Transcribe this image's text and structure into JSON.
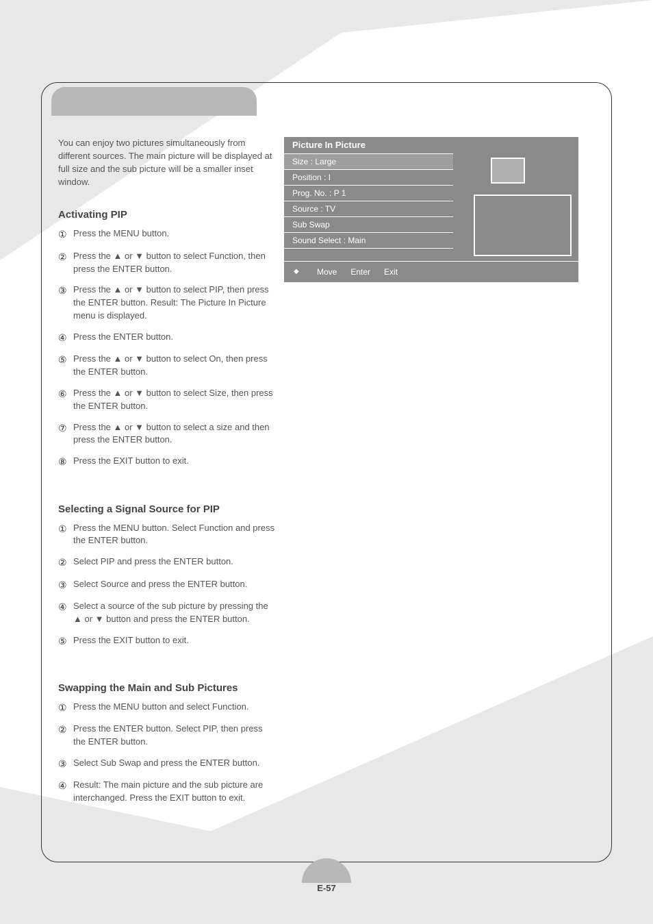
{
  "page": {
    "number": "E-57"
  },
  "tab_title": "Picture In Picture",
  "intro_text": "You can enjoy two pictures simultaneously from different sources. The main picture will be displayed at full size and the sub picture will be a smaller inset window.",
  "osd": {
    "header": "Picture In Picture",
    "rows": [
      "Size : Large",
      "Position : I",
      "Prog. No. : P 1",
      "Source : TV",
      "Sub Swap",
      "Sound Select : Main"
    ],
    "footer_move": "Move",
    "footer_enter": "Enter",
    "footer_exit": "Exit"
  },
  "sections": [
    {
      "title": "Activating PIP",
      "steps": [
        "Press the MENU button.",
        "Press the ▲ or ▼ button to select Function, then press the ENTER button.",
        "Press the ▲ or ▼ button to select PIP, then press the ENTER button. Result: The Picture In Picture menu is displayed.",
        "Press the ENTER button.",
        "Press the ▲ or ▼ button to select On, then press the ENTER button.",
        "Press the ▲ or ▼ button to select Size, then press the ENTER button.",
        "Press the ▲ or ▼ button to select a size and then press the ENTER button.",
        "Press the EXIT button to exit."
      ]
    },
    {
      "title": "Selecting a Signal Source for PIP",
      "steps": [
        "Press the MENU button. Select Function and press the ENTER button.",
        "Select PIP and press the ENTER button.",
        "Select Source and press the ENTER button.",
        "Select a source of the sub picture by pressing the ▲ or ▼ button and press the ENTER button.",
        "Press the EXIT button to exit."
      ]
    },
    {
      "title": "Swapping the Main and Sub Pictures",
      "steps": [
        "Press the MENU button and select Function.",
        "Press the ENTER button. Select PIP, then press the ENTER button.",
        "Select Sub Swap and press the ENTER button.",
        "Result: The main picture and the sub picture are interchanged. Press the EXIT button to exit."
      ]
    }
  ]
}
